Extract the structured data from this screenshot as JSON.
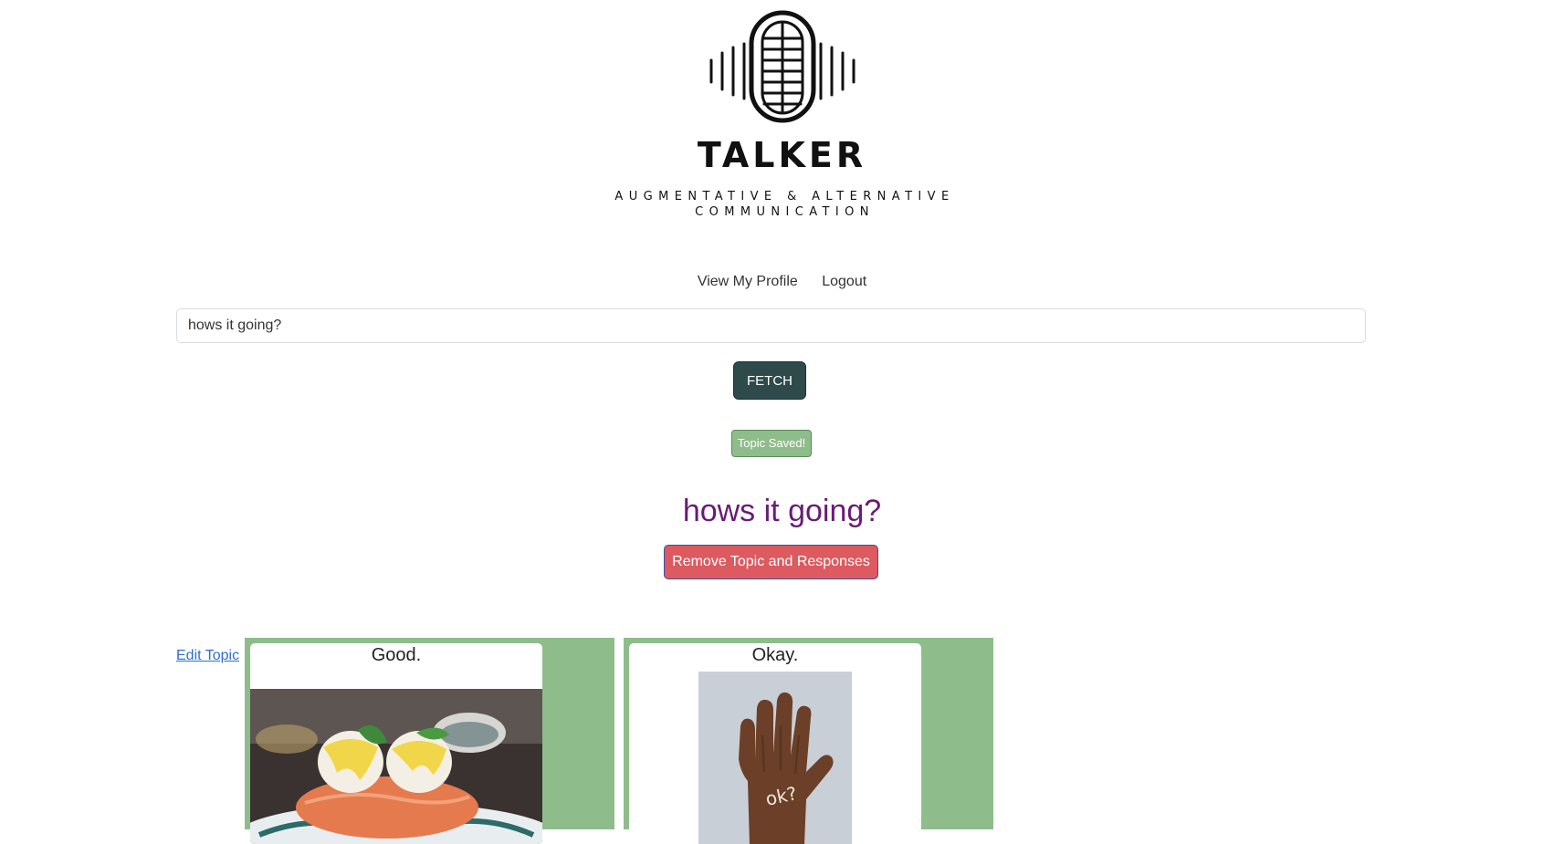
{
  "brand": {
    "name": "TALKER",
    "tagline_line1": "AUGMENTATIVE & ALTERNATIVE",
    "tagline_line2": "COMMUNICATION",
    "logo_icon": "microphone-soundwave-icon"
  },
  "nav": {
    "profile": "View My Profile",
    "logout": "Logout"
  },
  "search": {
    "value": "hows it going?"
  },
  "fetch_label": "FETCH",
  "saved_label": "Topic Saved!",
  "topic": {
    "title": "hows it going?",
    "remove_label": "Remove Topic and Responses",
    "edit_label": "Edit Topic"
  },
  "responses": [
    {
      "title": "Good.",
      "image": "eggs-benedict-photo"
    },
    {
      "title": "Okay.",
      "image": "hand-ok-photo",
      "image_text": "ok?"
    }
  ],
  "colors": {
    "fetch_bg": "#2e4a4b",
    "saved_bg": "#8fbc8b",
    "topic_title": "#6a1b78",
    "remove_bg": "#dc5a60",
    "response_bg": "#8fbc8b",
    "link": "#2f6fc8"
  }
}
